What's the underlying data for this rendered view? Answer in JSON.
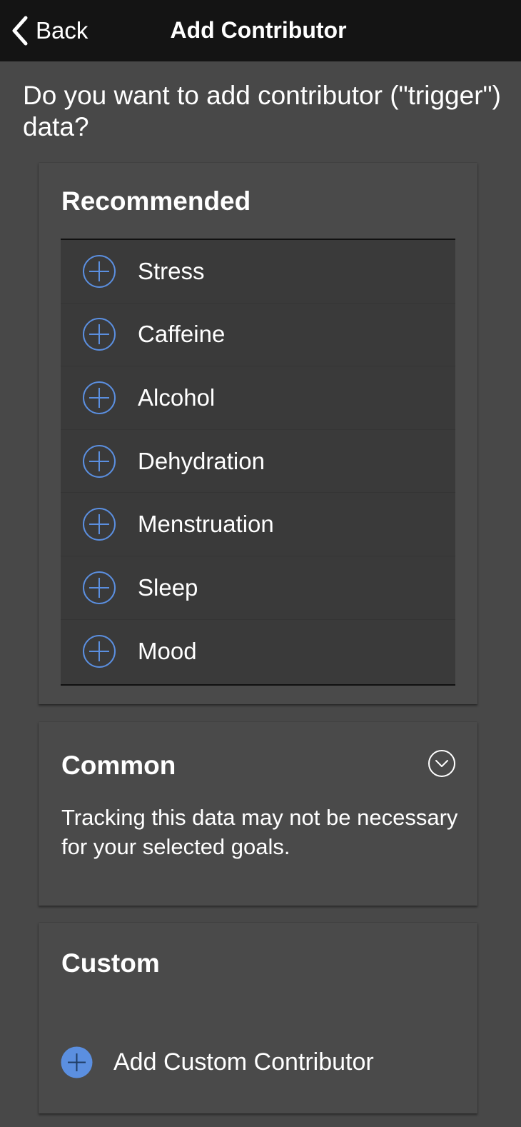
{
  "nav": {
    "back_label": "Back",
    "title": "Add Contributor"
  },
  "question": "Do you want to add contributor (\"trigger\") data?",
  "recommended": {
    "title": "Recommended",
    "items": [
      {
        "label": "Stress"
      },
      {
        "label": "Caffeine"
      },
      {
        "label": "Alcohol"
      },
      {
        "label": "Dehydration"
      },
      {
        "label": "Menstruation"
      },
      {
        "label": "Sleep"
      },
      {
        "label": "Mood"
      }
    ]
  },
  "common": {
    "title": "Common",
    "description": "Tracking this data may not be necessary for your selected goals.",
    "expanded": false
  },
  "custom": {
    "title": "Custom",
    "add_label": "Add Custom Contributor"
  },
  "colors": {
    "accent": "#5b8fe0",
    "background": "#484848",
    "nav_bar": "#141414",
    "list_bg": "#3a3a3a"
  },
  "icons": {
    "back": "chevron-left-icon",
    "add": "plus-circle-icon",
    "expand": "chevron-down-circle-icon"
  }
}
